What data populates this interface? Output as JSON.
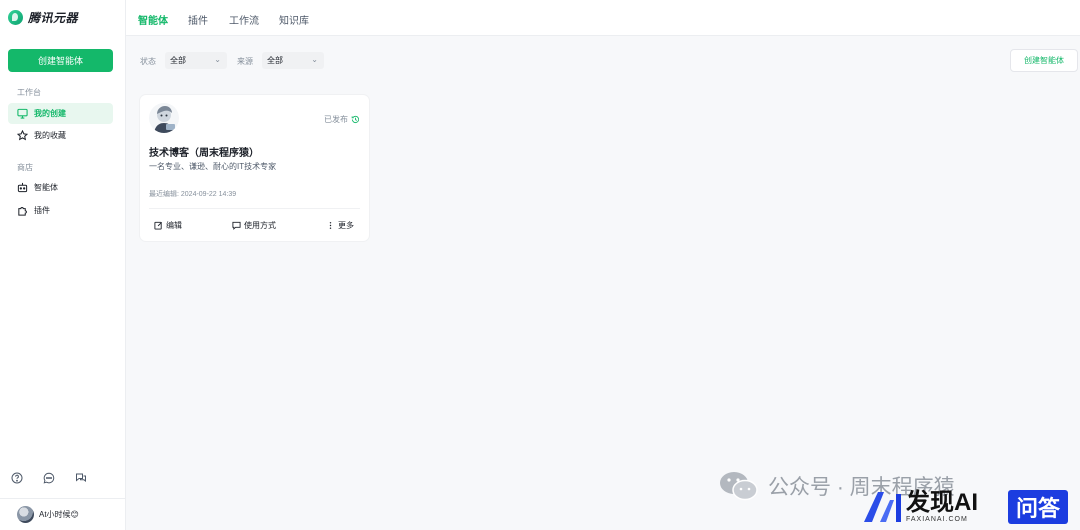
{
  "app": {
    "logo_text": "腾讯元器"
  },
  "sidebar": {
    "create_label": "创建智能体",
    "sections": [
      {
        "label": "工作台"
      },
      {
        "label": "商店"
      }
    ],
    "items": [
      {
        "label": "我的创建",
        "icon": "monitor-icon",
        "active": true
      },
      {
        "label": "我的收藏",
        "icon": "star-icon"
      },
      {
        "label": "智能体",
        "icon": "robot-icon"
      },
      {
        "label": "插件",
        "icon": "puzzle-icon"
      }
    ],
    "bottom_icons": [
      "help-icon",
      "chat-icon",
      "messages-icon"
    ],
    "user": {
      "name": "At小时候😊"
    }
  },
  "topbar": {
    "tabs": [
      {
        "label": "智能体",
        "active": true
      },
      {
        "label": "插件"
      },
      {
        "label": "工作流"
      },
      {
        "label": "知识库"
      }
    ]
  },
  "filters": {
    "status_label": "状态",
    "status_value": "全部",
    "source_label": "来源",
    "source_value": "全部"
  },
  "create_button_label": "创建智能体",
  "card": {
    "status": "已发布",
    "title": "技术博客（周末程序猿）",
    "description": "一名专业、谦逊、耐心的IT技术专家",
    "meta": "最近编辑: 2024-09-22 14:39",
    "actions": [
      {
        "label": "编辑",
        "icon": "edit-icon"
      },
      {
        "label": "使用方式",
        "icon": "comment-icon"
      },
      {
        "label": "更多",
        "icon": "more-icon"
      }
    ]
  },
  "watermark": {
    "wechat_text": "公众号 · 周末程序猿",
    "faxian_title": "发现AI",
    "faxian_sub": "FAXIANAI.COM",
    "wenda": "问答"
  },
  "colors": {
    "accent": "#14b86a",
    "accent_light": "#e8f7ef",
    "text": "#1d2129",
    "muted": "#86909c"
  }
}
